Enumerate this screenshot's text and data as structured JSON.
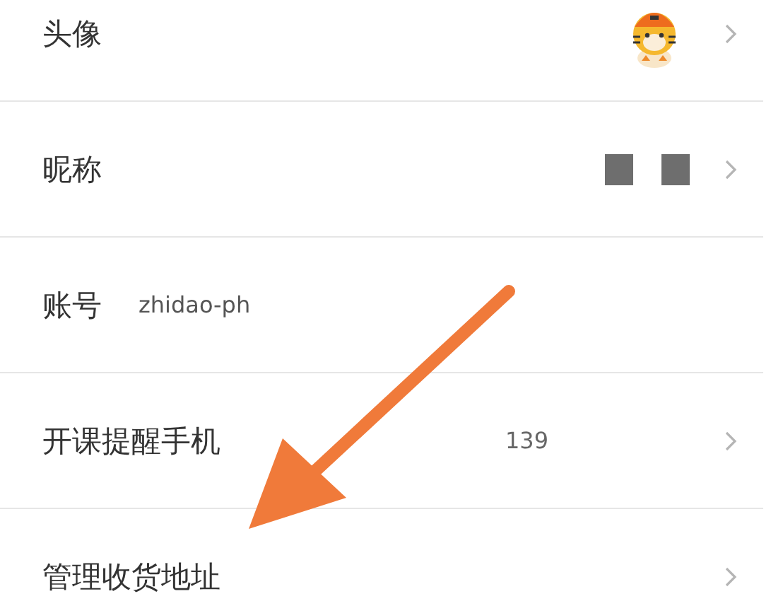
{
  "rows": [
    {
      "label": "头像",
      "kind": "avatar",
      "chevron": true
    },
    {
      "label": "昵称",
      "kind": "redacted",
      "chevron": true
    },
    {
      "label": "账号",
      "kind": "account",
      "value": "zhidao-ph",
      "chevron": false
    },
    {
      "label": "开课提醒手机",
      "kind": "value",
      "value": "139",
      "chevron": true
    },
    {
      "label": "管理收货地址",
      "kind": "plain",
      "chevron": true
    }
  ]
}
